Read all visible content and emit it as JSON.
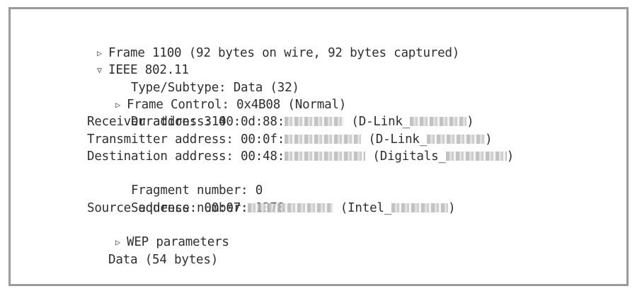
{
  "tree": {
    "frame": {
      "toggle": "▷",
      "label": "Frame 1100 (92 bytes on wire, 92 bytes captured)"
    },
    "ieee": {
      "toggle": "▽",
      "label": "IEEE 802.11"
    },
    "type_subtype": "Type/Subtype: Data (32)",
    "frame_control": {
      "toggle": "▷",
      "label": "Frame Control: 0x4B08 (Normal)"
    },
    "duration": "Duration: 314",
    "receiver": {
      "prefix": "Receiver address: 00:0d:88:",
      "mid": " (D-Link_",
      "suffix": ")"
    },
    "transmitter": {
      "prefix": "Transmitter address: 00:0f:",
      "mid": " (D-Link_",
      "suffix": ")"
    },
    "destination": {
      "prefix": "Destination address: 00:48:",
      "mid": " (Digitals_",
      "suffix": ")"
    },
    "fragment": "Fragment number: 0",
    "sequence": "Sequence number: 1378",
    "source": {
      "prefix": "Source address: 00:07:",
      "mid": " (Intel_",
      "suffix": ")"
    },
    "wep": {
      "toggle": "▷",
      "label": "WEP parameters"
    },
    "data": "Data (54 bytes)"
  }
}
